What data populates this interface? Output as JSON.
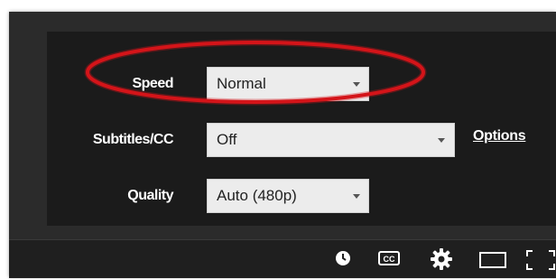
{
  "settings": {
    "speed": {
      "label": "Speed",
      "value": "Normal"
    },
    "subtitles": {
      "label": "Subtitles/CC",
      "value": "Off",
      "options_link": "Options"
    },
    "quality": {
      "label": "Quality",
      "value": "Auto (480p)"
    }
  },
  "annotation": {
    "color": "#d4141a",
    "target": "speed-row"
  },
  "controls": {
    "icons": [
      "watch-later-icon",
      "captions-icon",
      "settings-gear-icon",
      "theater-mode-icon",
      "fullscreen-icon"
    ]
  }
}
